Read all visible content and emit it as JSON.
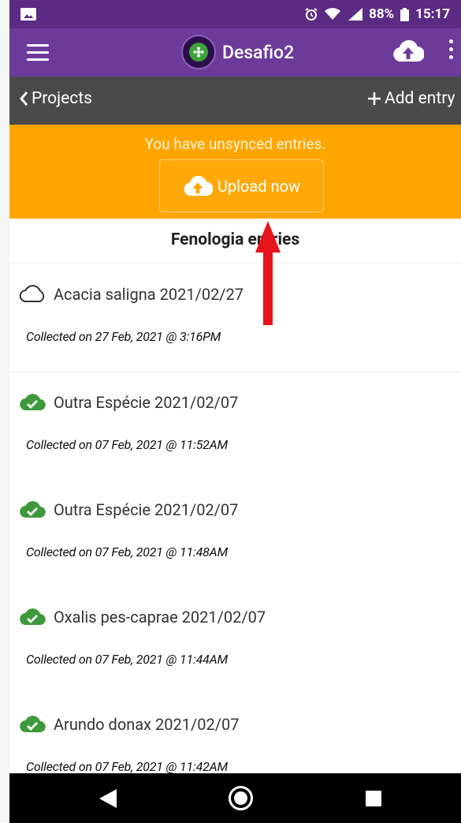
{
  "status": {
    "battery": "88%",
    "time": "15:17"
  },
  "app_bar": {
    "title": "Desafio2"
  },
  "nav": {
    "back_label": "Projects",
    "add_label": "Add entry"
  },
  "banner": {
    "message": "You have unsynced entries.",
    "upload_label": "Upload now"
  },
  "list": {
    "title": "Fenologia entries",
    "entries": [
      {
        "title": "Acacia saligna 2021/02/27",
        "collected": "Collected on 27 Feb, 2021 @ 3:16PM",
        "synced": false
      },
      {
        "title": "Outra Espécie 2021/02/07",
        "collected": "Collected on 07 Feb, 2021 @ 11:52AM",
        "synced": true
      },
      {
        "title": "Outra Espécie 2021/02/07",
        "collected": "Collected on 07 Feb, 2021 @ 11:48AM",
        "synced": true
      },
      {
        "title": "Oxalis pes-caprae 2021/02/07",
        "collected": "Collected on 07 Feb, 2021 @ 11:44AM",
        "synced": true
      },
      {
        "title": "Arundo donax 2021/02/07",
        "collected": "Collected on 07 Feb, 2021 @ 11:42AM",
        "synced": true
      }
    ]
  },
  "colors": {
    "status_bar": "#5b2b84",
    "app_bar": "#6c3b99",
    "nav_bar": "#4a4a4a",
    "banner": "#ffa500",
    "synced_icon": "#3d9a3a",
    "annotation_arrow": "#e8141c"
  },
  "icons": {
    "menu": "hamburger-icon",
    "upload_top": "cloud-upload-icon",
    "more": "kebab-icon",
    "back": "chevron-left-icon",
    "add": "plus-icon",
    "unsynced": "cloud-outline-icon",
    "synced": "cloud-check-icon"
  }
}
